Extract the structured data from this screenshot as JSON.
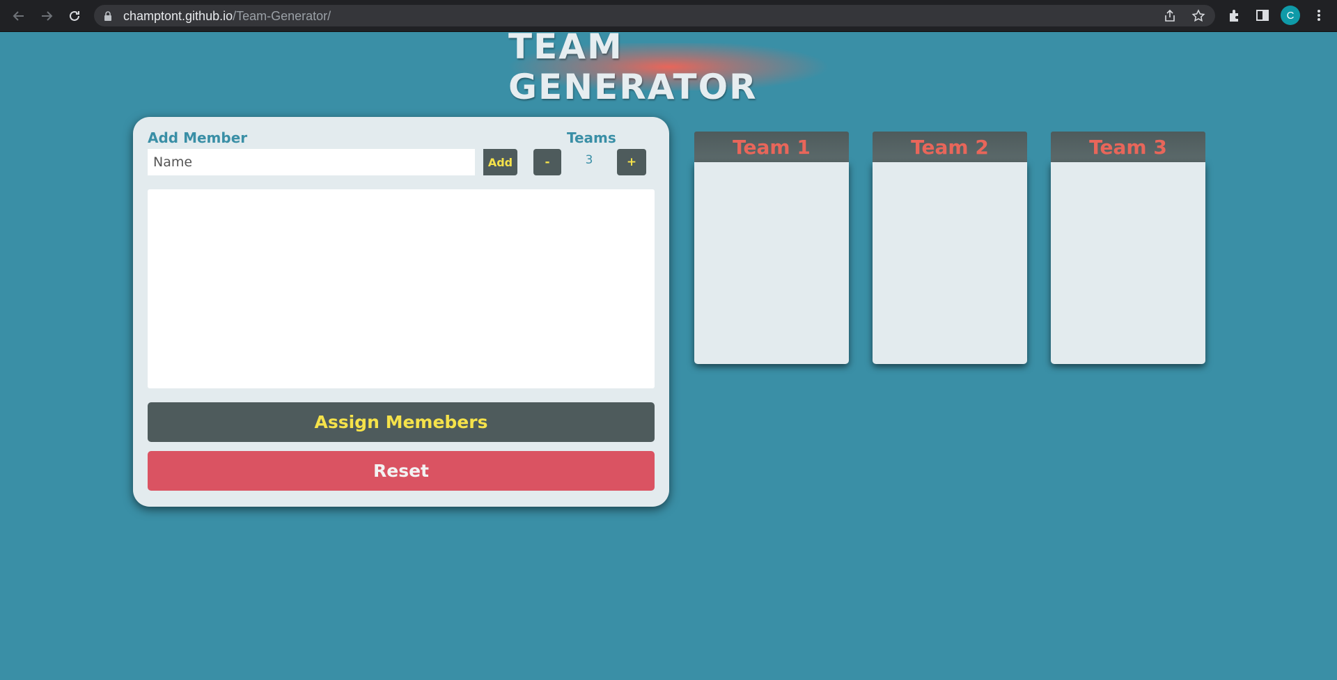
{
  "browser": {
    "url_host": "champtont.github.io",
    "url_path": "/Team-Generator/",
    "avatar_letter": "C",
    "icons": [
      "back-icon",
      "forward-icon",
      "reload-icon",
      "lock-icon",
      "share-icon",
      "star-icon",
      "extensions-icon",
      "side-panel-icon",
      "kebab-menu-icon"
    ]
  },
  "page": {
    "title": "TEAM GENERATOR"
  },
  "panel": {
    "add_member_label": "Add Member",
    "name_placeholder": "Name",
    "add_button": "Add",
    "teams_label": "Teams",
    "decrement_button": "-",
    "team_count": "3",
    "increment_button": "+",
    "assign_button": "Assign Memebers",
    "reset_button": "Reset"
  },
  "teams": [
    {
      "name": "Team 1"
    },
    {
      "name": "Team 2"
    },
    {
      "name": "Team 3"
    }
  ],
  "colors": {
    "page_background": "#3a8fa6",
    "panel_background": "#e3ebee",
    "dark_button": "#4e5b5c",
    "button_text_yellow": "#f5e24a",
    "reset_red": "#da5362",
    "team_title_coral": "#e8665a"
  }
}
